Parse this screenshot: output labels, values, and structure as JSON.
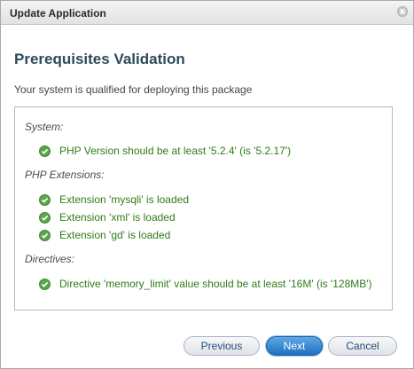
{
  "window": {
    "title": "Update Application",
    "close_icon": "close-icon"
  },
  "page": {
    "heading": "Prerequisites Validation",
    "subtitle": "Your system is qualified for deploying this package"
  },
  "sections": {
    "system": {
      "label": "System:",
      "items": [
        "PHP Version should be at least '5.2.4' (is '5.2.17')"
      ]
    },
    "php_extensions": {
      "label": "PHP Extensions:",
      "items": [
        "Extension 'mysqli' is loaded",
        "Extension 'xml' is loaded",
        "Extension 'gd' is loaded"
      ]
    },
    "directives": {
      "label": "Directives:",
      "items": [
        "Directive 'memory_limit' value should be at least '16M' (is '128MB')"
      ]
    }
  },
  "status_icon": "check-circle-icon",
  "colors": {
    "ok_text": "#2e7d17",
    "ok_icon": "#5aa54a",
    "heading": "#2c4a5a",
    "primary_button": "#1e6fbf"
  },
  "buttons": {
    "previous": "Previous",
    "next": "Next",
    "cancel": "Cancel"
  }
}
